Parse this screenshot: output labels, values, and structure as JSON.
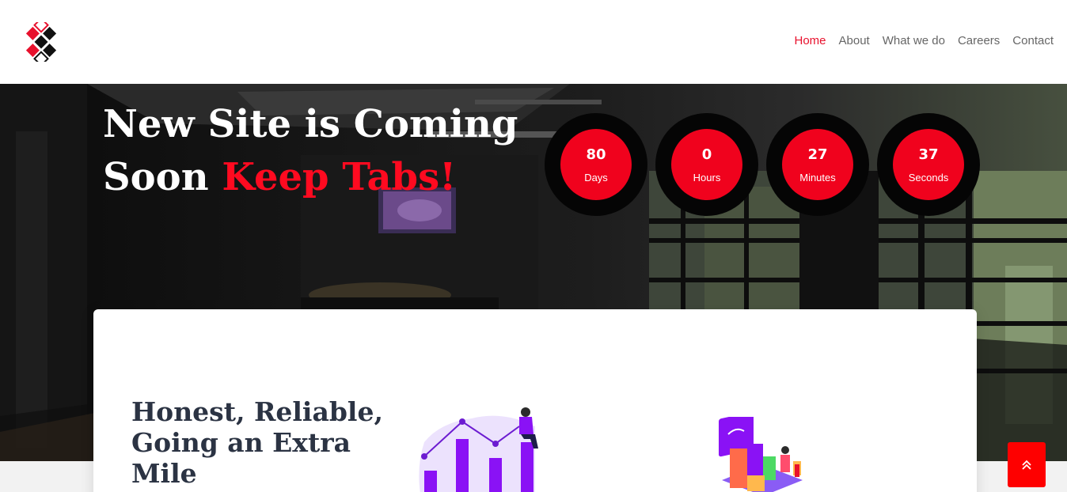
{
  "nav": {
    "items": [
      {
        "label": "Home",
        "active": true
      },
      {
        "label": "About",
        "active": false
      },
      {
        "label": "What we do",
        "active": false
      },
      {
        "label": "Careers",
        "active": false
      },
      {
        "label": "Contact",
        "active": false
      }
    ]
  },
  "hero": {
    "headline_line1": "New Site is Coming",
    "headline_line2_white": "Soon",
    "headline_line2_red": "Keep Tabs!"
  },
  "countdown": {
    "days": {
      "value": "80",
      "label": "Days"
    },
    "hours": {
      "value": "0",
      "label": "Hours"
    },
    "minutes": {
      "value": "27",
      "label": "Minutes"
    },
    "seconds": {
      "value": "37",
      "label": "Seconds"
    }
  },
  "card": {
    "heading": "Honest, Reliable, Going an Extra Mile"
  },
  "colors": {
    "accent": "#ff0a20",
    "nav_active": "#e8112d",
    "heading_dark": "#2b3343",
    "illustration_purple": "#8a12f5"
  },
  "icons": {
    "logo": "diamond-logo-icon",
    "back_to_top": "double-chevron-up-icon"
  }
}
